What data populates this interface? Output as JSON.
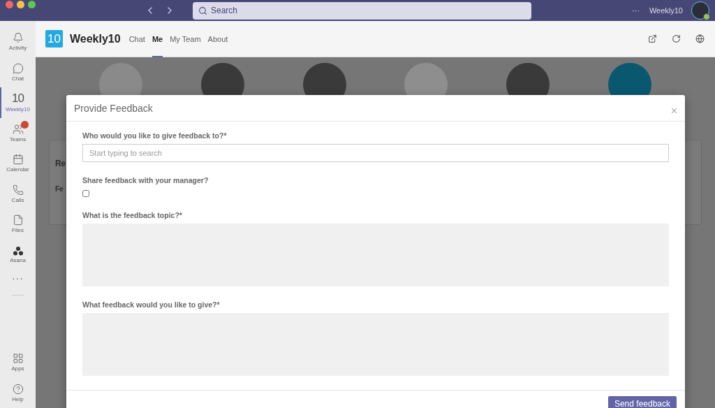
{
  "topbar": {
    "search": {
      "placeholder": "Search"
    },
    "more": "···",
    "account": "Weekly10"
  },
  "rail": {
    "items": [
      {
        "label": "Activity",
        "selected": false,
        "badge": false
      },
      {
        "label": "Chat",
        "selected": false,
        "badge": false
      },
      {
        "label": "Weekly10",
        "glyph": "10",
        "selected": true,
        "badge": false
      },
      {
        "label": "Teams",
        "selected": false,
        "badge": true
      },
      {
        "label": "Calendar",
        "selected": false,
        "badge": false
      },
      {
        "label": "Calls",
        "selected": false,
        "badge": false
      },
      {
        "label": "Files",
        "selected": false,
        "badge": false
      },
      {
        "label": "Asana",
        "selected": false,
        "badge": false
      }
    ],
    "more": "···",
    "bottom": [
      {
        "label": "Apps"
      },
      {
        "label": "Help"
      }
    ]
  },
  "app": {
    "logo": "10",
    "name": "Weekly10",
    "tabs": [
      {
        "label": "Chat",
        "selected": false
      },
      {
        "label": "Me",
        "selected": true
      },
      {
        "label": "My Team",
        "selected": false
      },
      {
        "label": "About",
        "selected": false
      }
    ]
  },
  "background": {
    "card_title": "Re",
    "row_label": "Fe"
  },
  "modal": {
    "title": "Provide Feedback",
    "close": "×",
    "fields": [
      {
        "kind": "input",
        "label": "Who would you like to give feedback to?*",
        "placeholder": "Start typing to search"
      },
      {
        "kind": "checkbox",
        "label": "Share feedback with your manager?",
        "checked": false
      },
      {
        "kind": "textarea",
        "label": "What is the feedback topic?*"
      },
      {
        "kind": "textarea",
        "label": "What feedback would you like to give?*"
      }
    ],
    "submit": "Send feedback"
  }
}
